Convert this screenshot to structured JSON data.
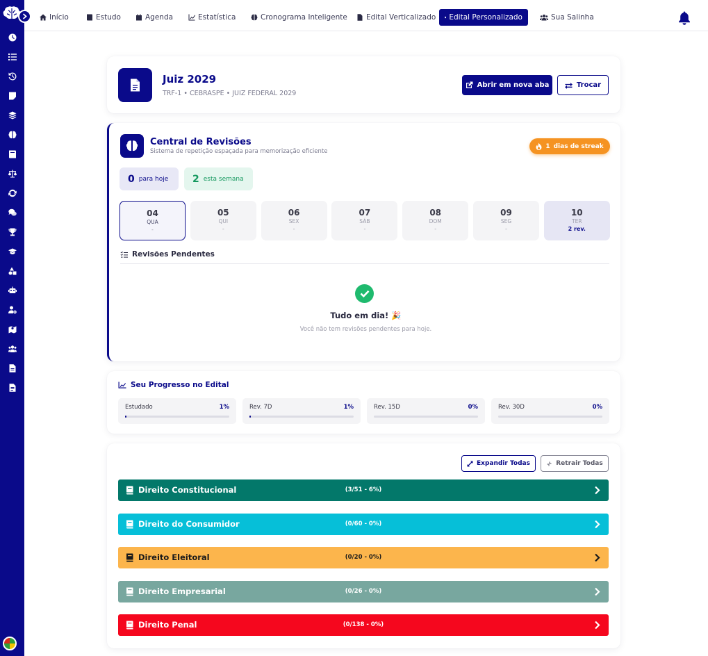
{
  "nav": {
    "items": [
      {
        "label": "Início",
        "icon": "home-icon"
      },
      {
        "label": "Estudo",
        "icon": "book-icon"
      },
      {
        "label": "Agenda",
        "icon": "calendar-icon"
      },
      {
        "label": "Estatística",
        "icon": "chart-icon"
      },
      {
        "label": "Cronograma Inteligente",
        "icon": "brain-icon"
      },
      {
        "label": "Edital Verticalizado",
        "icon": "file-icon"
      },
      {
        "label": "Edital Personalizado",
        "icon": "file-icon"
      },
      {
        "label": "Sua Salinha",
        "icon": "users-icon"
      }
    ],
    "active": "Edital Personalizado"
  },
  "sidebar": {
    "icons": [
      "clock-icon",
      "list-icon",
      "history-icon",
      "note-icon",
      "layers-icon",
      "brain-icon",
      "book-icon",
      "scale-icon",
      "sync-icon",
      "chat-icon",
      "trophy-icon",
      "graduation-icon",
      "shapes-icon",
      "robot-icon",
      "user-cog-icon",
      "map-icon",
      "users-icon",
      "file-icon",
      "file-alt-icon"
    ]
  },
  "edital": {
    "title": "Juiz 2029",
    "subtitle": "TRF-1 • CEBRASPE • JUIZ FEDERAL 2029",
    "open_new_tab": "Abrir em nova aba",
    "switch": "Trocar"
  },
  "revisoes": {
    "title": "Central de Revisões",
    "subtitle": "Sistema de repetição espaçada para memorização eficiente",
    "streak_num": "1",
    "streak_label": "dias de streak",
    "today_count": "0",
    "today_label": "para hoje",
    "week_count": "2",
    "week_label": "esta semana",
    "days": [
      {
        "day": "04",
        "weekday": "QUA",
        "count": "-"
      },
      {
        "day": "05",
        "weekday": "QUI",
        "count": "-"
      },
      {
        "day": "06",
        "weekday": "SEX",
        "count": "-"
      },
      {
        "day": "07",
        "weekday": "SÁB",
        "count": "-"
      },
      {
        "day": "08",
        "weekday": "DOM",
        "count": "-"
      },
      {
        "day": "09",
        "weekday": "SEG",
        "count": "-"
      },
      {
        "day": "10",
        "weekday": "TER",
        "count": "2 rev."
      }
    ],
    "pending_title": "Revisões Pendentes",
    "ok_title": "Tudo em dia! 🎉",
    "ok_subtitle": "Você não tem revisões pendentes para hoje."
  },
  "progresso": {
    "title": "Seu Progresso no Edital",
    "items": [
      {
        "label": "Estudado",
        "value": "1%",
        "percent": 1
      },
      {
        "label": "Rev. 7D",
        "value": "1%",
        "percent": 1
      },
      {
        "label": "Rev. 15D",
        "value": "0%",
        "percent": 0
      },
      {
        "label": "Rev. 30D",
        "value": "0%",
        "percent": 0
      }
    ]
  },
  "disciplinas": {
    "expand_all": "Expandir Todas",
    "collapse_all": "Retrair Todas",
    "items": [
      {
        "name": "Direito Constitucional",
        "count": "(3/51 - 6%)",
        "color": "#03786a",
        "text": "#ffffff"
      },
      {
        "name": "Direito do Consumidor",
        "count": "(0/60 - 0%)",
        "color": "#06bfd8",
        "text": "#ffffff"
      },
      {
        "name": "Direito Eleitoral",
        "count": "(0/20 - 0%)",
        "color": "#fcb54c",
        "text": "#1a1a1a"
      },
      {
        "name": "Direito Empresarial",
        "count": "(0/26 - 0%)",
        "color": "#78a79f",
        "text": "#ffffff"
      },
      {
        "name": "Direito Penal",
        "count": "(0/138 - 0%)",
        "color": "#f5071e",
        "text": "#ffffff"
      }
    ]
  }
}
